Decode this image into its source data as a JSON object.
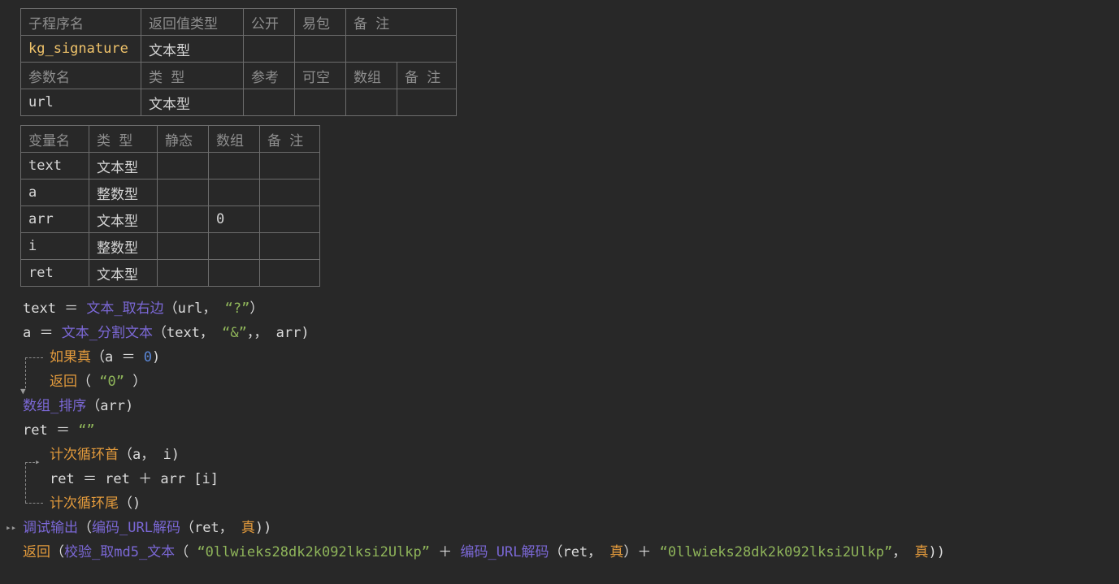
{
  "subroutine_table": {
    "header": [
      "子程序名",
      "返回值类型",
      "公开",
      "易包",
      "备 注"
    ],
    "row": [
      "kg_signature",
      "文本型",
      "",
      "",
      ""
    ],
    "param_header": [
      "参数名",
      "类 型",
      "参考",
      "可空",
      "数组",
      "备 注"
    ],
    "param_row": [
      "url",
      "文本型",
      "",
      "",
      "",
      ""
    ]
  },
  "variable_table": {
    "header": [
      "变量名",
      "类 型",
      "静态",
      "数组",
      "备 注"
    ],
    "rows": [
      [
        "text",
        "文本型",
        "",
        "",
        ""
      ],
      [
        "a",
        "整数型",
        "",
        "",
        ""
      ],
      [
        "arr",
        "文本型",
        "",
        "0",
        ""
      ],
      [
        "i",
        "整数型",
        "",
        "",
        ""
      ],
      [
        "ret",
        "文本型",
        "",
        "",
        ""
      ]
    ]
  },
  "code": {
    "l1": [
      "text ＝ ",
      "文本_取右边",
      "（url， ",
      "“?”",
      "）"
    ],
    "l2": [
      "a ＝ ",
      "文本_分割文本",
      "（text， ",
      "“&”",
      "，， arr)"
    ],
    "l3": [
      "如果真",
      "（a ＝ ",
      "0",
      ")"
    ],
    "l4": [
      "返回",
      "（ ",
      "“0”",
      " ）"
    ],
    "l5": [
      "数组_排序",
      "（arr)"
    ],
    "l6": [
      "ret ＝ ",
      "“”"
    ],
    "l7": [
      "计次循环首",
      "（a， i)"
    ],
    "l8": [
      "ret ＝ ret ＋ arr [i]"
    ],
    "l9": [
      "计次循环尾",
      "（)"
    ],
    "l10": [
      "调试输出",
      "（",
      "编码_URL解码",
      "（ret， ",
      "真",
      "))"
    ],
    "l11": [
      "返回",
      "（",
      "校验_取md5_文本",
      "（ ",
      "“0llwieks28dk2k092lksi2Ulkp”",
      " ＋ ",
      "编码_URL解码",
      "（ret， ",
      "真",
      "）＋ ",
      "“0llwieks28dk2k092lksi2Ulkp”",
      "， ",
      "真",
      "))"
    ]
  },
  "colors": {
    "background": "#282828",
    "grid_line": "#6c6c6c",
    "header_text": "#8e8e8e",
    "subroutine_name": "#f0c36a",
    "function": "#7b68d6",
    "keyword": "#e29a3c",
    "string": "#8fb55a",
    "number": "#5a87d8"
  }
}
